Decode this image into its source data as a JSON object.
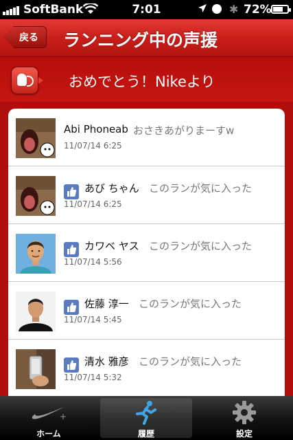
{
  "status_bar": {
    "carrier": "SoftBank",
    "time": "7:01",
    "battery": "72%",
    "battery_level": 0.72
  },
  "nav": {
    "back_label": "戻る",
    "title": "ランニング中の声援"
  },
  "notice": {
    "text": "おめでとう！Nikeより"
  },
  "entries": [
    {
      "name": "Abi Phoneab",
      "comment": "おさきあがりまーすw",
      "date": "11/07/14  6:25",
      "liked": false,
      "avatar": "cat"
    },
    {
      "name": "あび ちゃん",
      "comment": "このランが気に入った",
      "date": "11/07/14  6:25",
      "liked": true,
      "avatar": "cat"
    },
    {
      "name": "カワベ ヤス",
      "comment": "このランが気に入った",
      "date": "11/07/14  5:56",
      "liked": true,
      "avatar": "cartoon-man"
    },
    {
      "name": "佐藤 淳一",
      "comment": "このランが気に入った",
      "date": "11/07/14  5:45",
      "liked": true,
      "avatar": "man-photo"
    },
    {
      "name": "清水 雅彦",
      "comment": "このランが気に入った",
      "date": "11/07/14  5:32",
      "liked": true,
      "avatar": "phone-photo"
    }
  ],
  "tabs": [
    {
      "label": "ホーム",
      "icon": "nike-swoosh-icon",
      "active": false
    },
    {
      "label": "履歴",
      "icon": "runner-icon",
      "active": true
    },
    {
      "label": "設定",
      "icon": "gear-icon",
      "active": false
    }
  ]
}
